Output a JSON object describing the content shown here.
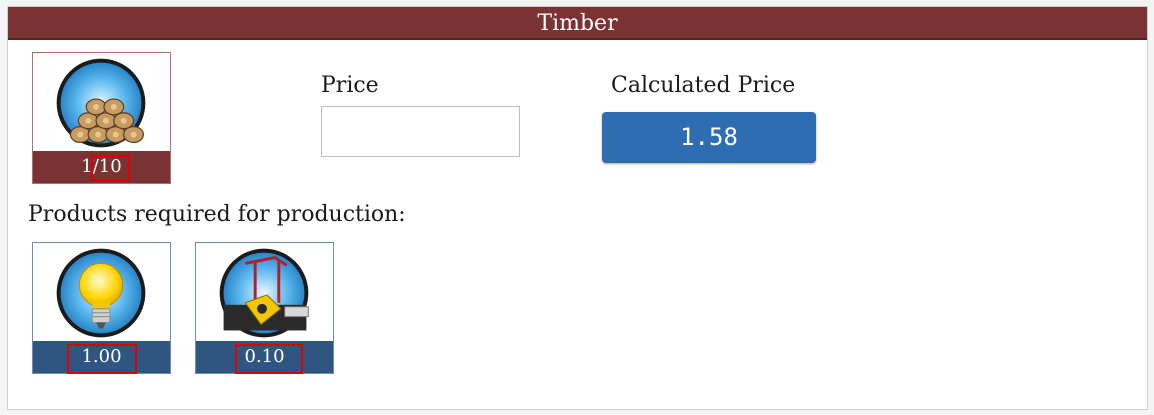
{
  "header": {
    "title": "Timber"
  },
  "product": {
    "name": "timber",
    "quantity_label": "1/10",
    "icon": "timber-logs-icon"
  },
  "price_field": {
    "label": "Price",
    "value": "",
    "placeholder": ""
  },
  "calculated": {
    "label": "Calculated Price",
    "value": "1.58"
  },
  "requirements": {
    "heading": "Products required for production:",
    "items": [
      {
        "icon": "lightbulb-icon",
        "amount": "1.00"
      },
      {
        "icon": "machinery-icon",
        "amount": "0.10"
      }
    ]
  },
  "colors": {
    "title_bg": "#7a3232",
    "product_footer": "#7a3232",
    "requirement_footer": "#2f5680",
    "calc_bg": "#2f6db3",
    "highlight": "#e00000"
  }
}
